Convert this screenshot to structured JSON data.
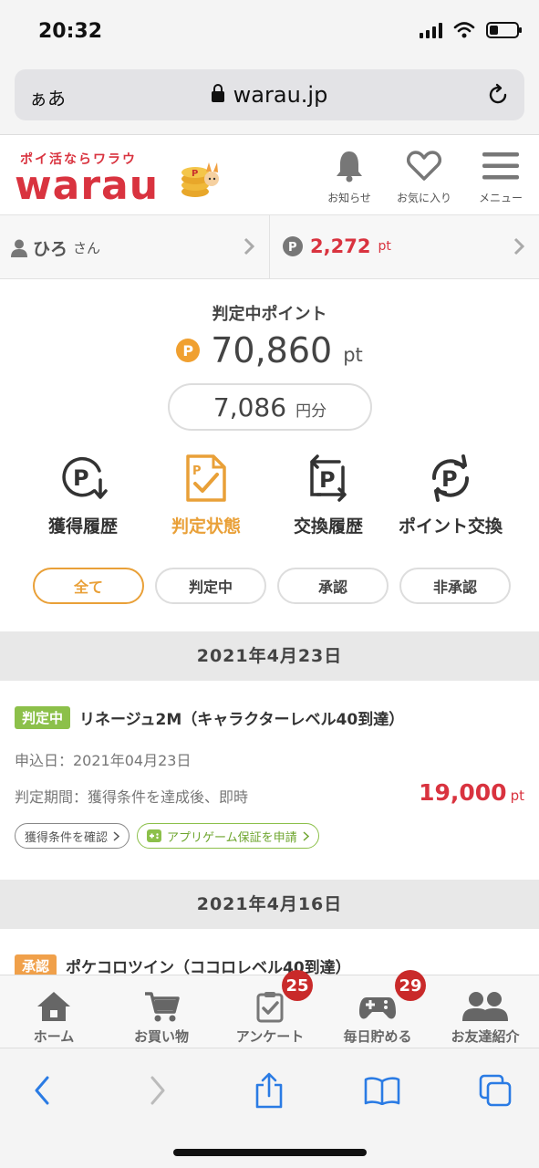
{
  "status": {
    "time": "20:32"
  },
  "browser": {
    "text_size_label": "ぁあ",
    "url": "warau.jp"
  },
  "header": {
    "logo_tagline": "ポイ活ならワラウ",
    "logo_text": "warau",
    "notifications_label": "お知らせ",
    "favorites_label": "お気に入り",
    "menu_label": "メニュー"
  },
  "user": {
    "name": "ひろ",
    "honorific": "さん",
    "points": "2,272",
    "points_unit": "pt"
  },
  "summary": {
    "title": "判定中ポイント",
    "points": "70,860",
    "points_unit": "pt",
    "yen_value": "7,086",
    "yen_unit": "円分"
  },
  "nav": [
    {
      "label": "獲得履歴",
      "icon": "p-download-icon"
    },
    {
      "label": "判定状態",
      "icon": "p-check-document-icon"
    },
    {
      "label": "交換履歴",
      "icon": "p-exchange-icon"
    },
    {
      "label": "ポイント交換",
      "icon": "p-cycle-icon"
    }
  ],
  "active_nav": "判定状態",
  "filters": [
    "全て",
    "判定中",
    "承認",
    "非承認"
  ],
  "active_filter": "全て",
  "groups": [
    {
      "date": "2021年4月23日",
      "entries": [
        {
          "status": "判定中",
          "title": "リネージュ2M（キャラクターレベル40到達）",
          "apply_date": "申込日：2021年04月23日",
          "period": "判定期間：獲得条件を達成後、即時",
          "points": "19,000",
          "points_unit": "pt",
          "link1": "獲得条件を確認",
          "link2": "アプリゲーム保証を申請"
        }
      ]
    },
    {
      "date": "2021年4月16日",
      "entries": [
        {
          "status": "承認",
          "title": "ポケコロツイン（ココロレベル40到達）"
        }
      ]
    }
  ],
  "tabs": [
    {
      "label": "ホーム",
      "icon": "home-icon"
    },
    {
      "label": "お買い物",
      "icon": "cart-icon"
    },
    {
      "label": "アンケート",
      "icon": "clipboard-check-icon",
      "badge": "25"
    },
    {
      "label": "毎日貯める",
      "icon": "gamepad-icon",
      "badge": "29"
    },
    {
      "label": "お友達紹介",
      "icon": "friends-icon"
    }
  ],
  "colors": {
    "brand_red": "#d9333f",
    "accent_orange": "#e9a038",
    "status_green": "#8cc04a",
    "badge_red": "#c92a2a"
  }
}
